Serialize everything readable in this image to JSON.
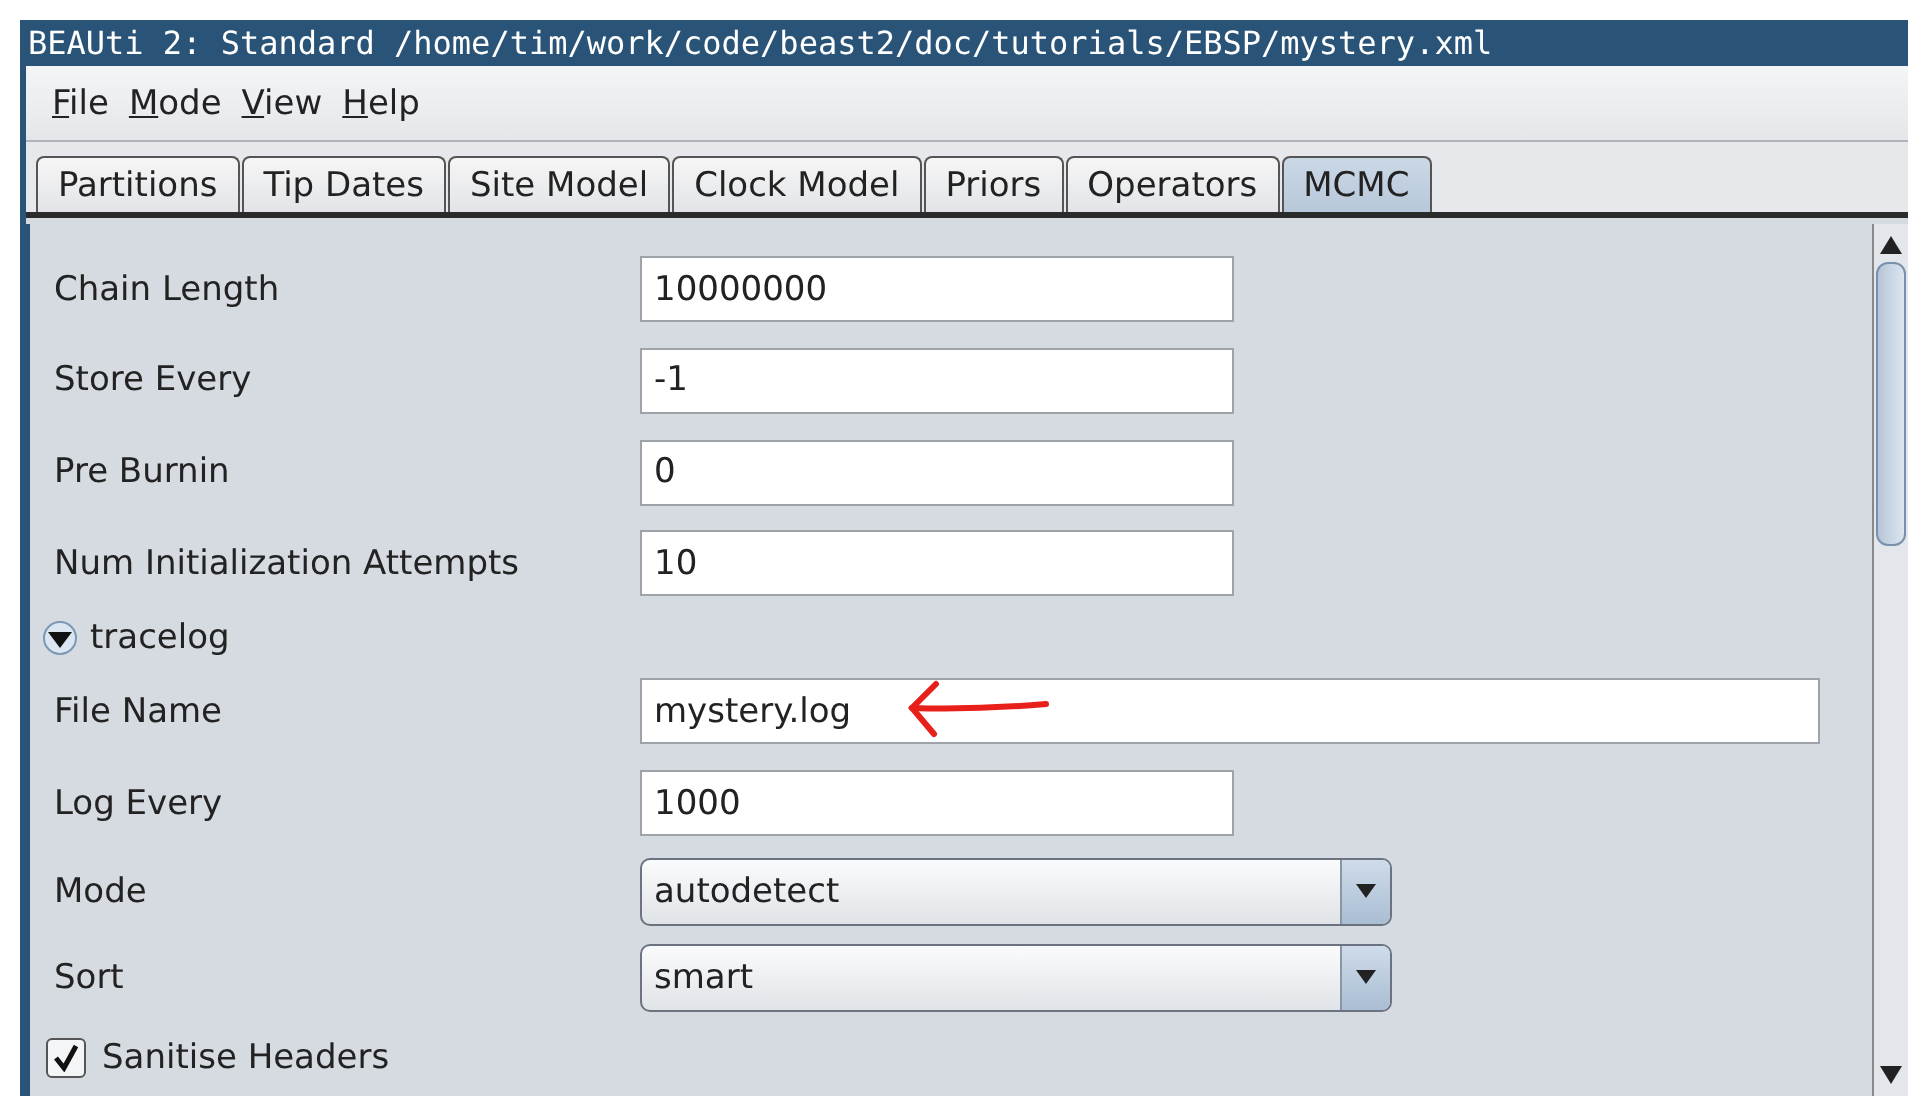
{
  "window": {
    "title": "BEAUti 2: Standard /home/tim/work/code/beast2/doc/tutorials/EBSP/mystery.xml"
  },
  "menu": [
    "File",
    "Mode",
    "View",
    "Help"
  ],
  "tabs": [
    {
      "label": "Partitions",
      "selected": false
    },
    {
      "label": "Tip Dates",
      "selected": false
    },
    {
      "label": "Site Model",
      "selected": false
    },
    {
      "label": "Clock Model",
      "selected": false
    },
    {
      "label": "Priors",
      "selected": false
    },
    {
      "label": "Operators",
      "selected": false
    },
    {
      "label": "MCMC",
      "selected": true
    }
  ],
  "items": [
    {
      "kind": "text",
      "label": "Chain Length",
      "value": "10000000"
    },
    {
      "kind": "text",
      "label": "Store Every",
      "value": "-1"
    },
    {
      "kind": "text",
      "label": "Pre Burnin",
      "value": "0"
    },
    {
      "kind": "text",
      "label": "Num Initialization Attempts",
      "value": "10"
    },
    {
      "kind": "section",
      "label": "tracelog",
      "expanded": true
    },
    {
      "kind": "text",
      "label": "File Name",
      "value": "mystery.log",
      "wide": true,
      "annotated": true
    },
    {
      "kind": "text",
      "label": "Log Every",
      "value": "1000"
    },
    {
      "kind": "combo",
      "label": "Mode",
      "value": "autodetect"
    },
    {
      "kind": "combo",
      "label": "Sort",
      "value": "smart"
    },
    {
      "kind": "check",
      "label": "Sanitise Headers",
      "checked": true
    }
  ]
}
